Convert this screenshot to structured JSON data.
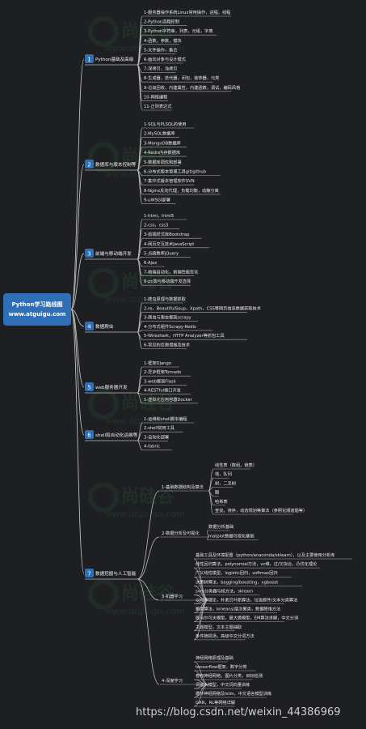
{
  "root": {
    "title": "Python学习路线图",
    "site": "www.atguigu.com"
  },
  "watermark": {
    "brand": "尚硅谷",
    "url": "www.atguigu.com"
  },
  "footer_url": "https://blog.csdn.net/weixin_44386969",
  "sections": [
    {
      "num": "1",
      "title": "Python基础及高级",
      "items": [
        "1-服务器操作系统Linux常用操作，进程，线程",
        "2-Python流程控制",
        "3-Python字符串，列表，元组，字典",
        "4-函数，参数，模块",
        "5-文件操作，集合",
        "6-面向对象与设计模式",
        "7-深拷贝，浅拷贝",
        "8-生成器，迭代器，闭包，装饰器，元类",
        "9-垃圾回收，内建属性，内建函数，调试，编码风格",
        "10-网络编程",
        "11-正则表达式"
      ]
    },
    {
      "num": "2",
      "title": "数据库与版本控制等",
      "items": [
        "1-SQL与PLSQL的使用",
        "2-MySQL数据库",
        "3-MongoDB数据库",
        "4-Redis内存数据库",
        "5-数据库调优和部署",
        "6-分布式版本管理工具git/github",
        "7-集中式版本管理软件SVN",
        "8-Nginx反向代理，负载均衡，动静分离",
        "9-uWSGI部署"
      ]
    },
    {
      "num": "3",
      "title": "前端与移动端开发",
      "items": [
        "1-html，html5",
        "2-css，css3",
        "3-前端样式库Bootstrap",
        "4-网页交互技术JavaScript",
        "5-JS函数库jQuery",
        "6-Ajax",
        "7-前端自动化，前端性能优化",
        "8-pc端与移动端开发选择"
      ]
    },
    {
      "num": "4",
      "title": "数据爬虫",
      "items": [
        "1-爬虫原理与数据抓取",
        "2-re，BeautifulSoup，Xpath，CSS等网页信息数据获取技术",
        "3-爬虫与爬虫框架scrapy",
        "4-分布式组件Scrapy-Redis",
        "5-Wireshark，HTTP Analyzer等抓包工具",
        "6-常见的反爬措施及技术"
      ]
    },
    {
      "num": "5",
      "title": "web服务器开发",
      "items": [
        "1-框架Django",
        "2-异步框架Tornado",
        "3-web框架Flask",
        "4-RESTful接口开发",
        "5-虚拟化应用容器Docker"
      ]
    },
    {
      "num": "6",
      "title": "shell和自动化运维等",
      "items": [
        "1-运维和shell脚本编程",
        "2-shell常用工具",
        "3-自动化部署",
        "4-fabric"
      ]
    },
    {
      "num": "7",
      "title": "数据挖掘与人工智能",
      "groups": [
        {
          "title": "1-基础数据结构及算法",
          "items": [
            "线性表（数组，链表）",
            "栈，队列",
            "树，二叉树",
            "图",
            "哈希表",
            "查找，排序，动态规划等算法（参照化顺道题等）"
          ]
        },
        {
          "title": "2-数据分析及可视化",
          "items": [
            "数据分析基础",
            "matplot数据可视化基础"
          ]
        },
        {
          "title": "3-机器学习",
          "items": [
            "基础工具及环境配置（python/anaconda/sklearn），以及主要使用分析库",
            "线性回归算法，polynomial方法，vc维，过/欠拟合，凸优化理论",
            "广义线性模型，logistic回归，softmax回归",
            "决策树算法，bagging/boosting，xgboost",
            "svm分类器与核方法，sklearn",
            "以时序理论，朴素贝叶斯算法，垃圾邮件/文本分类算法",
            "聚类算法，kmeans/层次聚类，数据降维方法",
            "隐马尔可夫模型，最大熵模型，EM算法求解，中文分词",
            "主题模型，文本主题抽取",
            "条件随机场，高级中文分词方法"
          ]
        },
        {
          "title": "4-深度学习",
          "items": [
            "神经网络原理及基础",
            "tensorflow框架，数字分类",
            "卷积神经网络，图片分类，目标检测",
            "词嵌入模型，中文词向量训练",
            "循环神经网络及lstm，中文语言模型训练",
            "GAN，RL等网络详解"
          ]
        }
      ]
    }
  ]
}
